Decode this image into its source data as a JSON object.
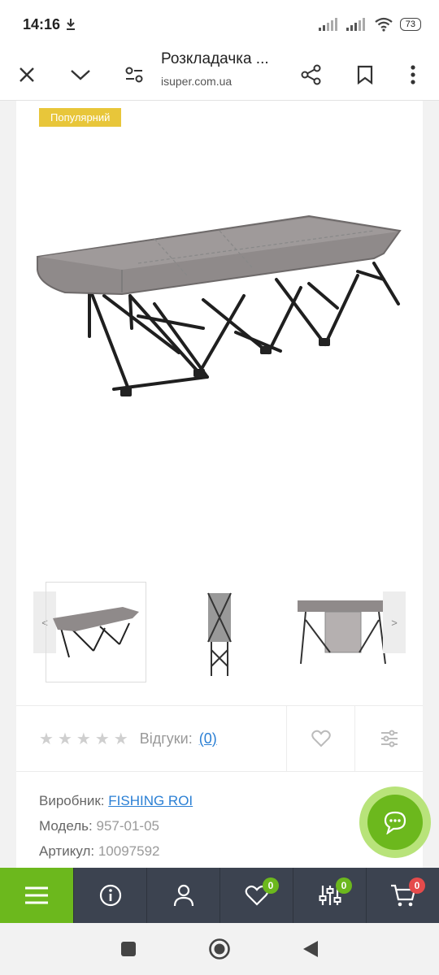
{
  "status_bar": {
    "time": "14:16",
    "battery": "73"
  },
  "browser": {
    "title": "Розкладачка ...",
    "domain": "isuper.com.ua"
  },
  "product": {
    "badge": "Популярний",
    "thumb_prev": "<",
    "thumb_next": ">",
    "reviews_label": "Відгуки:",
    "reviews_count": "(0)",
    "specs": [
      {
        "label": "Виробник:",
        "value": "FISHING ROI"
      },
      {
        "label": "Модель:",
        "value": "957-01-05"
      },
      {
        "label": "Артикул:",
        "value": "10097592"
      }
    ]
  },
  "bottom_nav": {
    "wishlist_count": "0",
    "compare_count": "0",
    "cart_count": "0"
  },
  "colors": {
    "accent_green": "#6cb81d",
    "badge_yellow": "#e8c63a",
    "nav_dark": "#3c4350",
    "link_blue": "#2a7fd4",
    "cart_badge_red": "#e54b4b"
  }
}
